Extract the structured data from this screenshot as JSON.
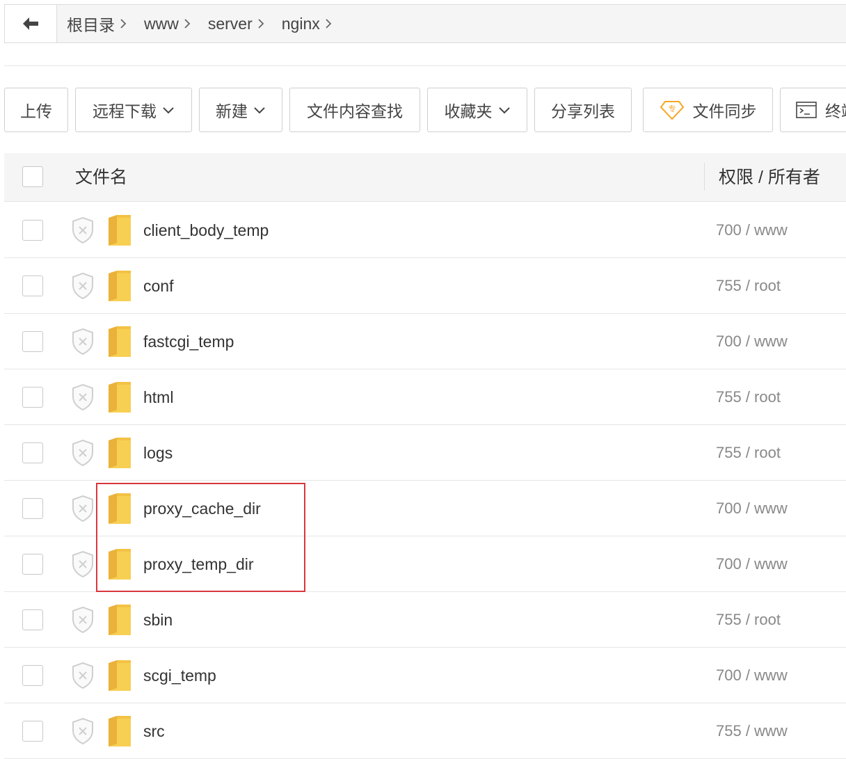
{
  "breadcrumb": {
    "back_icon": "arrow-left-icon",
    "items": [
      {
        "label": "根目录"
      },
      {
        "label": "www"
      },
      {
        "label": "server"
      },
      {
        "label": "nginx"
      }
    ]
  },
  "toolbar": {
    "upload": "上传",
    "remote_download": "远程下载",
    "new": "新建",
    "content_search": "文件内容查找",
    "favorites": "收藏夹",
    "share_list": "分享列表",
    "file_sync": "文件同步",
    "file_sync_badge": "专",
    "terminal": "终端"
  },
  "table": {
    "header_name": "文件名",
    "header_perm": "权限 / 所有者",
    "rows": [
      {
        "name": "client_body_temp",
        "perm": "700 / www"
      },
      {
        "name": "conf",
        "perm": "755 / root"
      },
      {
        "name": "fastcgi_temp",
        "perm": "700 / www"
      },
      {
        "name": "html",
        "perm": "755 / root"
      },
      {
        "name": "logs",
        "perm": "755 / root"
      },
      {
        "name": "proxy_cache_dir",
        "perm": "700 / www"
      },
      {
        "name": "proxy_temp_dir",
        "perm": "700 / www"
      },
      {
        "name": "sbin",
        "perm": "755 / root"
      },
      {
        "name": "scgi_temp",
        "perm": "700 / www"
      },
      {
        "name": "src",
        "perm": "755 / www"
      }
    ]
  },
  "colors": {
    "folder": "#f7cf53",
    "highlight": "#d9363e",
    "badge": "#f5a623"
  }
}
